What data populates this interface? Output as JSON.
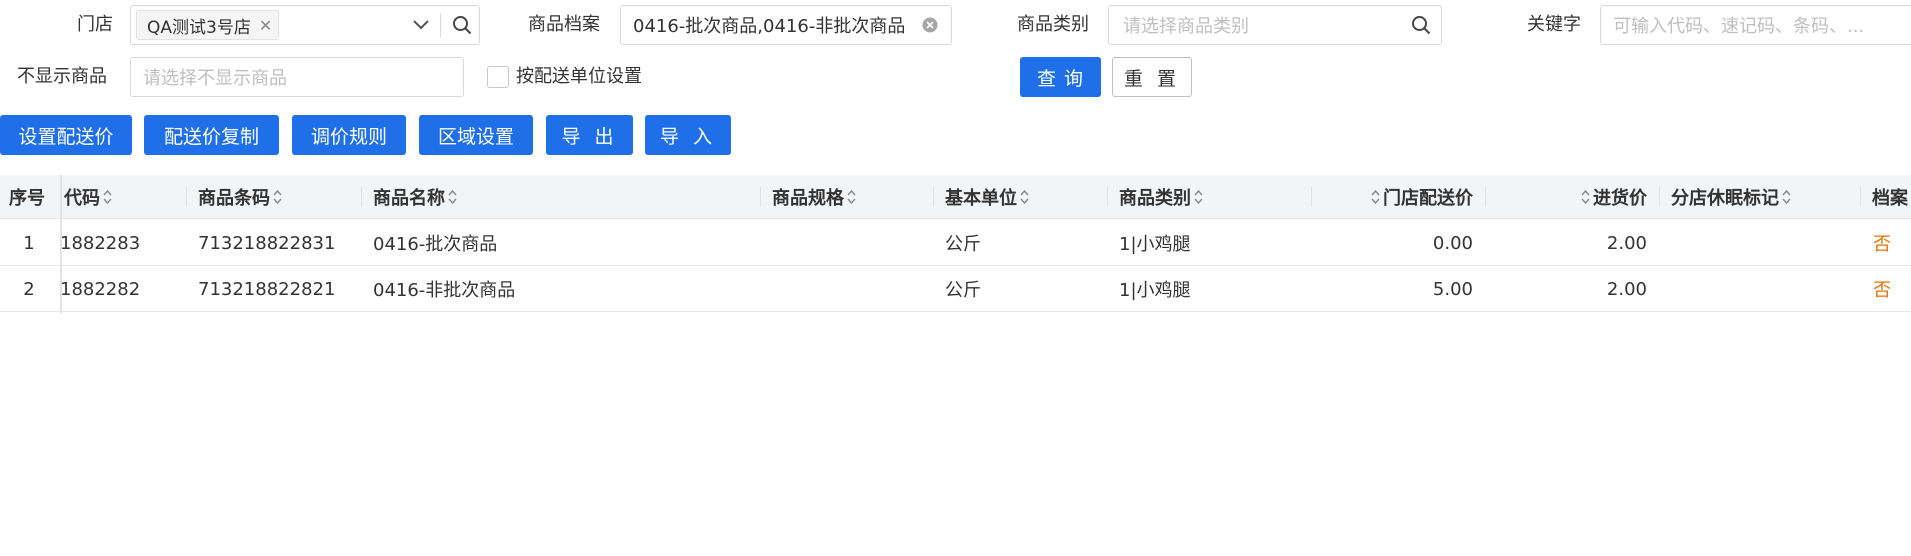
{
  "filters": {
    "store": {
      "label": "门店",
      "tag": "QA测试3号店"
    },
    "product_archive": {
      "label": "商品档案",
      "value": "0416-批次商品,0416-非批次商品"
    },
    "category": {
      "label": "商品类别",
      "placeholder": "请选择商品类别"
    },
    "keyword": {
      "label": "关键字",
      "placeholder": "可输入代码、速记码、条码、..."
    },
    "hidden_products": {
      "label": "不显示商品",
      "placeholder": "请选择不显示商品"
    },
    "by_delivery_unit": {
      "label": "按配送单位设置"
    },
    "query_button": "查 询",
    "reset_button": "重 置"
  },
  "toolbar": {
    "set_price": "设置配送价",
    "copy_price": "配送价复制",
    "price_rule": "调价规则",
    "area_setting": "区域设置",
    "export": "导 出",
    "import": "导 入"
  },
  "table": {
    "columns": [
      "序号",
      "代码",
      "商品条码",
      "商品名称",
      "商品规格",
      "基本单位",
      "商品类别",
      "门店配送价",
      "进货价",
      "分店休眠标记",
      "档案"
    ],
    "rows": [
      {
        "index": "1",
        "code": "1882283",
        "barcode": "713218822831",
        "name": "0416-批次商品",
        "spec": "",
        "unit": "公斤",
        "category": "1|小鸡腿",
        "delivery_price": "0.00",
        "purchase_price": "2.00",
        "sleep_flag": "",
        "archive": "否"
      },
      {
        "index": "2",
        "code": "1882282",
        "barcode": "713218822821",
        "name": "0416-非批次商品",
        "spec": "",
        "unit": "公斤",
        "category": "1|小鸡腿",
        "delivery_price": "5.00",
        "purchase_price": "2.00",
        "sleep_flag": "",
        "archive": "否"
      }
    ]
  },
  "colors": {
    "primary": "#1f6fe8",
    "orange": "#e6720a",
    "header_bg": "#f3f4f6"
  }
}
